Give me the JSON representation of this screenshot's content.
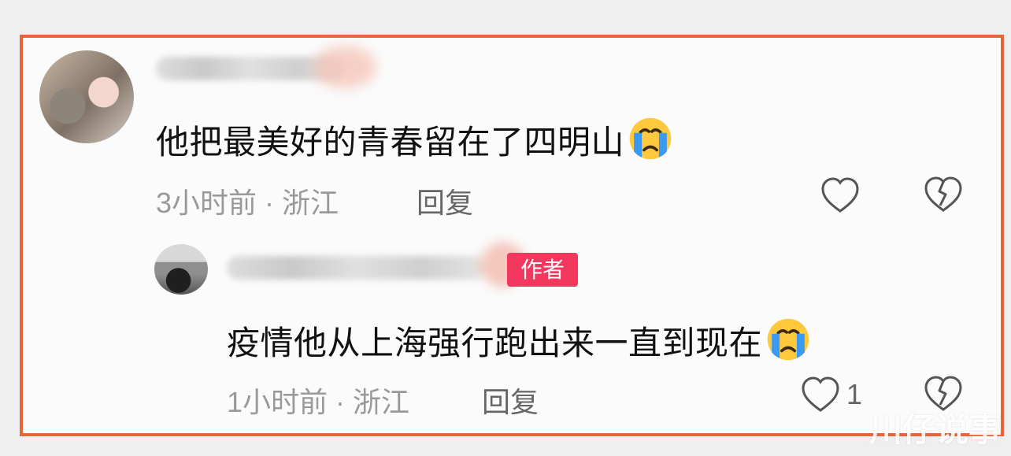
{
  "comments": [
    {
      "text": "他把最美好的青春留在了四明山",
      "meta": "3小时前 · 浙江",
      "reply_label": "回复"
    },
    {
      "text": "疫情他从上海强行跑出来一直到现在",
      "meta": "1小时前 · 浙江",
      "reply_label": "回复",
      "author_badge": "作者",
      "like_count": "1"
    }
  ],
  "watermark": "川仔说事",
  "colors": {
    "highlight_border": "#e8653a",
    "author_badge": "#f2385f",
    "meta_text": "#9a9a9a",
    "main_text": "#111111"
  },
  "icons": {
    "emoji": "crying-face-icon",
    "like": "heart-icon",
    "dislike": "broken-heart-icon"
  }
}
